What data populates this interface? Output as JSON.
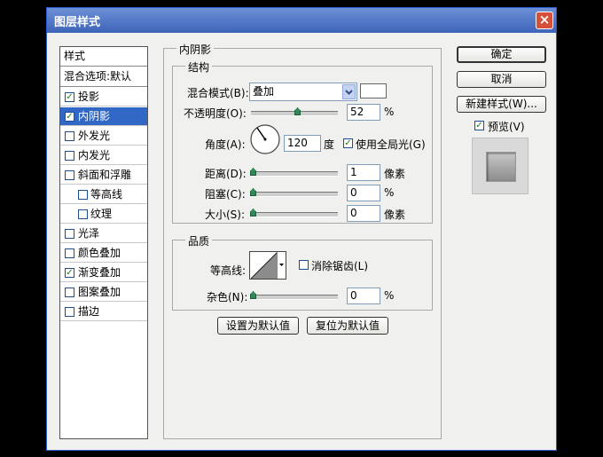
{
  "window": {
    "title": "图层样式",
    "close_symbol": "×"
  },
  "styles_list": {
    "header": "样式",
    "blend_defaults": "混合选项:默认",
    "items": [
      {
        "label": "投影",
        "checked": true
      },
      {
        "label": "内阴影",
        "checked": true,
        "selected": true
      },
      {
        "label": "外发光",
        "checked": false
      },
      {
        "label": "内发光",
        "checked": false
      },
      {
        "label": "斜面和浮雕",
        "checked": false
      },
      {
        "label": "等高线",
        "checked": false,
        "sub": true
      },
      {
        "label": "纹理",
        "checked": false,
        "sub": true
      },
      {
        "label": "光泽",
        "checked": false
      },
      {
        "label": "颜色叠加",
        "checked": false
      },
      {
        "label": "渐变叠加",
        "checked": true
      },
      {
        "label": "图案叠加",
        "checked": false
      },
      {
        "label": "描边",
        "checked": false
      }
    ]
  },
  "panel": {
    "title": "内阴影"
  },
  "structure": {
    "title": "结构",
    "blend_mode_label": "混合模式(B):",
    "blend_mode_value": "叠加",
    "opacity_label": "不透明度(O):",
    "opacity_value": "52",
    "opacity_unit": "%",
    "angle_label": "角度(A):",
    "angle_value": "120",
    "angle_unit": "度",
    "global_light_label": "使用全局光(G)",
    "global_light_checked": true,
    "distance_label": "距离(D):",
    "distance_value": "1",
    "distance_unit": "像素",
    "choke_label": "阻塞(C):",
    "choke_value": "0",
    "choke_unit": "%",
    "size_label": "大小(S):",
    "size_value": "0",
    "size_unit": "像素"
  },
  "quality": {
    "title": "品质",
    "contour_label": "等高线:",
    "antialias_label": "消除锯齿(L)",
    "antialias_checked": false,
    "noise_label": "杂色(N):",
    "noise_value": "0",
    "noise_unit": "%"
  },
  "buttons": {
    "set_default": "设置为默认值",
    "reset_default": "复位为默认值",
    "ok": "确定",
    "cancel": "取消",
    "new_style": "新建样式(W)...",
    "preview_label": "预览(V)",
    "preview_checked": true
  },
  "checkmark": "✓",
  "colors": {
    "selection": "#3168c5",
    "titlebar": "#3e64b9",
    "shadow_color_swatch": "#ffffff"
  }
}
